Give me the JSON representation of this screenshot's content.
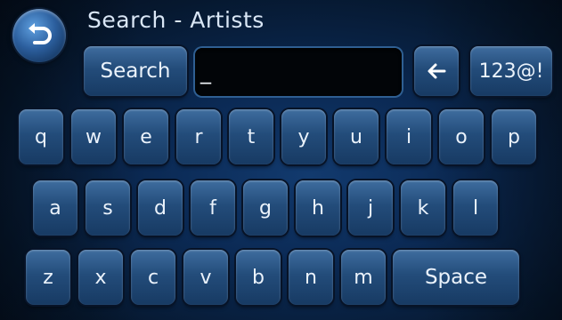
{
  "header": {
    "title": "Search - Artists",
    "back_icon": "back-arrow-icon"
  },
  "search": {
    "button_label": "Search",
    "input_value": "_",
    "backspace_icon": "left-arrow-icon",
    "symbols_label": "123@!"
  },
  "keyboard": {
    "row1": [
      "q",
      "w",
      "e",
      "r",
      "t",
      "y",
      "u",
      "i",
      "o",
      "p"
    ],
    "row2": [
      "a",
      "s",
      "d",
      "f",
      "g",
      "h",
      "j",
      "k",
      "l"
    ],
    "row3": [
      "z",
      "x",
      "c",
      "v",
      "b",
      "n",
      "m"
    ],
    "space_label": "Space"
  }
}
